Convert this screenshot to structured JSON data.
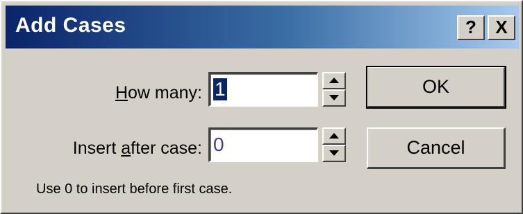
{
  "dialog": {
    "title": "Add Cases",
    "help_button": "?",
    "close_button": "X"
  },
  "fields": {
    "how_many": {
      "label_prefix": "",
      "label_accel": "H",
      "label_rest": "ow many:",
      "value": "1"
    },
    "insert_after": {
      "label_prefix": "Insert ",
      "label_accel": "a",
      "label_rest": "fter case:",
      "value": "0"
    }
  },
  "buttons": {
    "ok": "OK",
    "cancel": "Cancel"
  },
  "hint": "Use 0 to insert before first case."
}
